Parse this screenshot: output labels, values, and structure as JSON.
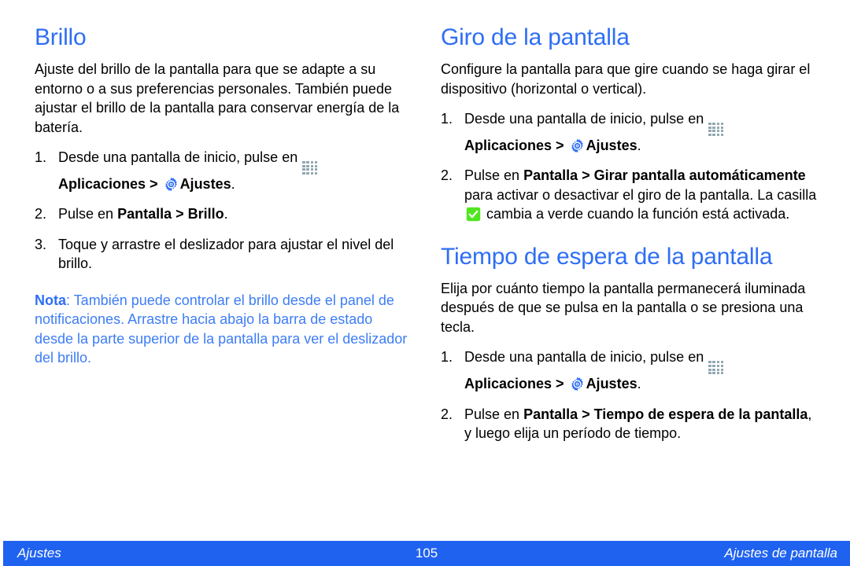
{
  "document": {
    "colors": {
      "heading_blue": "#2e6ef5",
      "note_blue": "#3d7df5",
      "footer_blue": "#1f62f0",
      "checkbox_green": "#4fe620",
      "apps_icon_gray": "#8fa7b0",
      "body_black": "#000000"
    }
  },
  "left_column": {
    "sections": [
      {
        "title": "Brillo",
        "intro": "Ajuste del brillo de la pantalla para que se adapte a su entorno o a sus preferencias personales. También puede ajustar el brillo de la pantalla para conservar energía de la batería.",
        "steps": [
          {
            "number": "1.",
            "text_before_apps_icon": "Desde una pantalla de inicio, pulse en ",
            "apps_label": "Aplicaciones",
            "separator": " > ",
            "settings_label": "Ajustes",
            "text_after": "."
          },
          {
            "number": "2.",
            "lead": "Pulse en ",
            "bold_1": "Pantalla",
            "separator": " > ",
            "bold_2": "Brillo",
            "text_after": "."
          },
          {
            "number": "3.",
            "text": "Toque y arrastre el deslizador para ajustar el nivel del brillo."
          }
        ],
        "note": {
          "label": "Nota",
          "text": ": También puede controlar el brillo desde el panel de notificaciones. Arrastre hacia abajo la barra de estado desde la parte superior de la pantalla para ver el deslizador del brillo."
        }
      }
    ]
  },
  "right_column": {
    "sections": [
      {
        "title": "Giro de la pantalla",
        "intro": "Configure la pantalla para que gire cuando se haga girar el dispositivo (horizontal o vertical).",
        "steps": [
          {
            "number": "1.",
            "text_before_apps_icon": "Desde una pantalla de inicio, pulse en ",
            "apps_label": "Aplicaciones",
            "separator": " > ",
            "settings_label": "Ajustes",
            "text_after": "."
          },
          {
            "number": "2.",
            "lead": "Pulse en ",
            "bold_1": "Pantalla",
            "separator": " > ",
            "bold_2": "Girar pantalla automáticamente",
            "middle": " para activar o desactivar el giro de la pantalla. La casilla ",
            "after_checkbox": " cambia a verde cuando la función está activada."
          }
        ]
      },
      {
        "title": "Tiempo de espera de la pantalla",
        "intro": "Elija por cuánto tiempo la pantalla permanecerá iluminada después de que se pulsa en la pantalla o se presiona una tecla.",
        "steps": [
          {
            "number": "1.",
            "text_before_apps_icon": "Desde una pantalla de inicio, pulse en ",
            "apps_label": "Aplicaciones",
            "separator": " > ",
            "settings_label": "Ajustes",
            "text_after": "."
          },
          {
            "number": "2.",
            "lead": "Pulse en ",
            "bold_1": "Pantalla",
            "separator": " > ",
            "bold_2": "Tiempo de espera de la pantalla",
            "text_after": ", y luego elija un período de tiempo."
          }
        ]
      }
    ]
  },
  "footer": {
    "left": "Ajustes",
    "page_number": "105",
    "right": "Ajustes de pantalla"
  },
  "icons": {
    "apps": "apps-grid-icon",
    "settings": "gear-icon",
    "checkbox": "green-checkbox-icon"
  }
}
